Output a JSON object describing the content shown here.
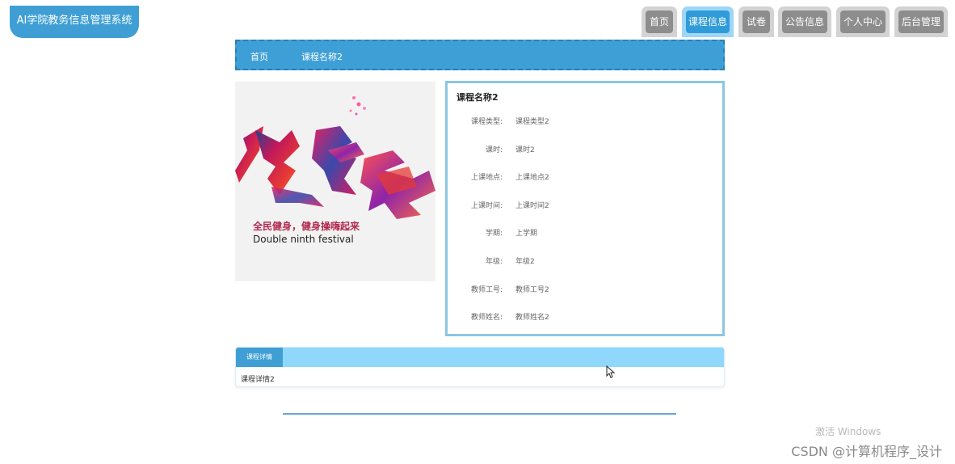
{
  "header": {
    "logo_text": "AI学院教务信息管理系统"
  },
  "nav": {
    "items": [
      {
        "label": "首页"
      },
      {
        "label": "课程信息"
      },
      {
        "label": "试卷"
      },
      {
        "label": "公告信息"
      },
      {
        "label": "个人中心"
      },
      {
        "label": "后台管理"
      }
    ],
    "active_index": 1
  },
  "breadcrumb": {
    "home": "首页",
    "current": "课程名称2"
  },
  "course_image": {
    "art_text": "健身操",
    "slogan": "全民健身，健身操嗨起来",
    "subtitle": "Double ninth festival"
  },
  "course": {
    "title": "课程名称2",
    "fields": [
      {
        "label": "课程类型:",
        "value": "课程类型2"
      },
      {
        "label": "课时:",
        "value": "课时2"
      },
      {
        "label": "上课地点:",
        "value": "上课地点2"
      },
      {
        "label": "上课时间:",
        "value": "上课时间2"
      },
      {
        "label": "学期:",
        "value": "上学期"
      },
      {
        "label": "年级:",
        "value": "年级2"
      },
      {
        "label": "教师工号:",
        "value": "教师工号2"
      },
      {
        "label": "教师姓名:",
        "value": "教师姓名2"
      }
    ]
  },
  "detail": {
    "tab_label": "课程详情",
    "content": "课程详情2"
  },
  "watermarks": {
    "windows": "激活 Windows",
    "csdn": "CSDN @计算机程序_设计"
  },
  "colors": {
    "primary": "#3f9fd4",
    "nav_inactive": "#8d8d8d",
    "panel_border": "#8cc6e3",
    "detail_header": "#8fd8fc"
  }
}
